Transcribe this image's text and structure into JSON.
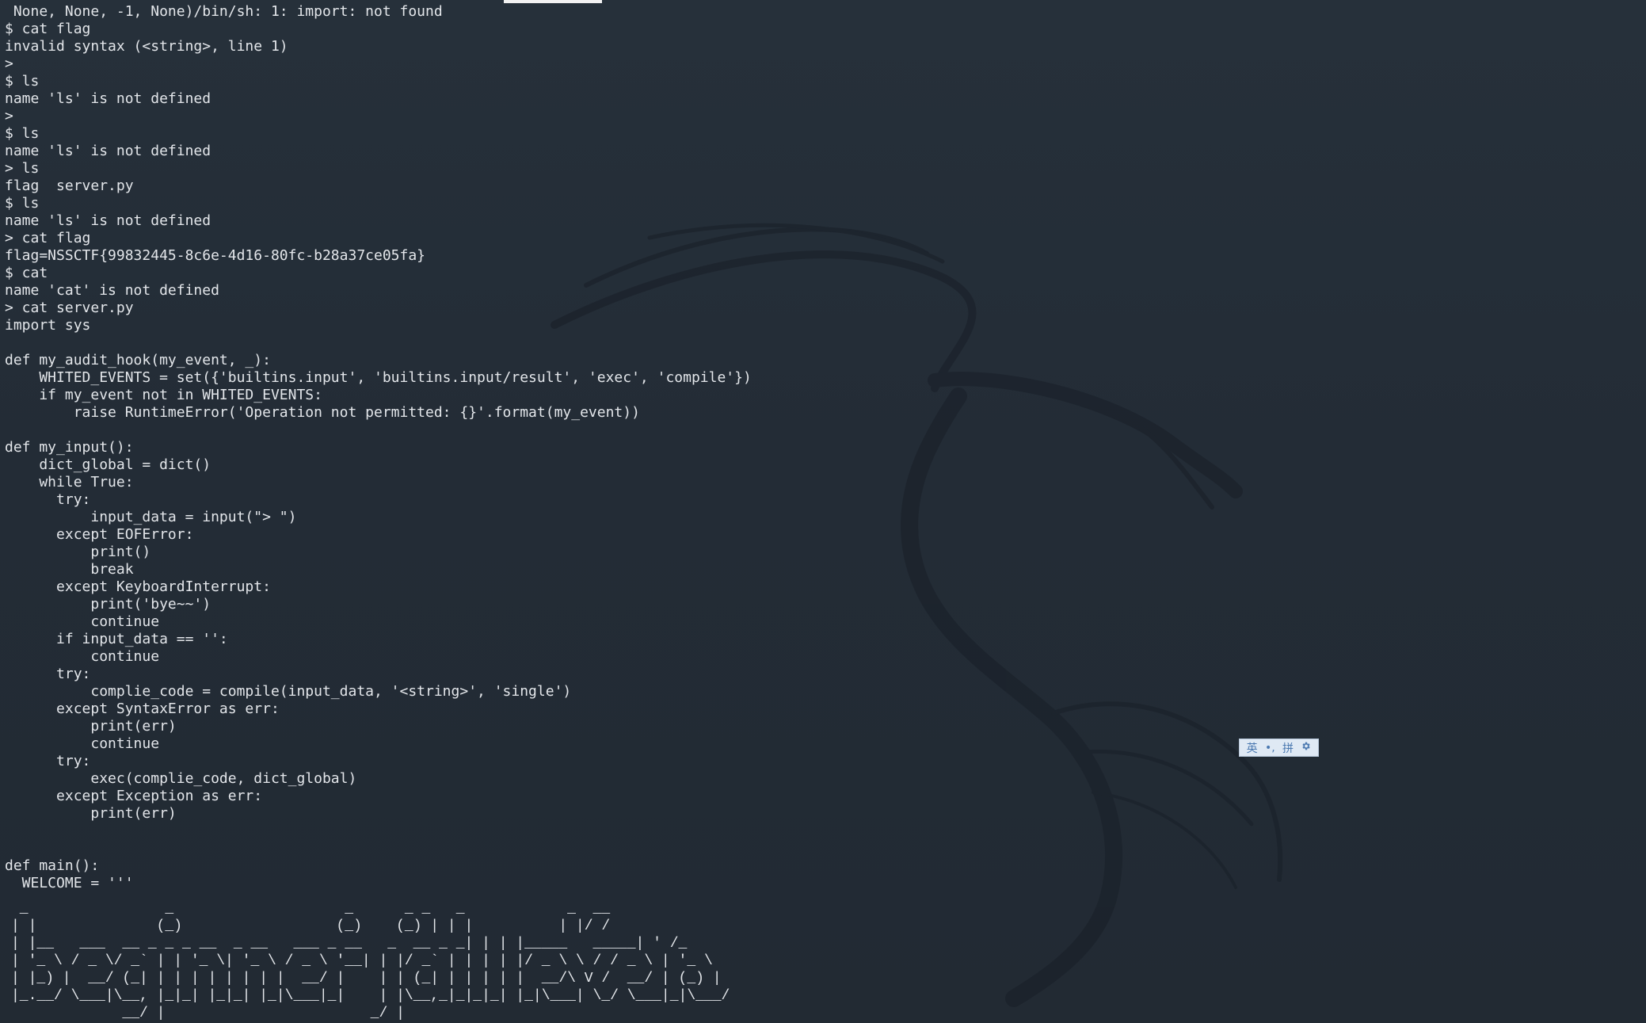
{
  "terminal": {
    "lines": [
      " None, None, -1, None)/bin/sh: 1: import: not found",
      "$ cat flag",
      "invalid syntax (<string>, line 1)",
      ">",
      "$ ls",
      "name 'ls' is not defined",
      ">",
      "$ ls",
      "name 'ls' is not defined",
      "> ls",
      "flag  server.py",
      "$ ls",
      "name 'ls' is not defined",
      "> cat flag",
      "flag=NSSCTF{99832445-8c6e-4d16-80fc-b28a37ce05fa}",
      "$ cat",
      "name 'cat' is not defined",
      "> cat server.py",
      "import sys",
      "",
      "def my_audit_hook(my_event, _):",
      "    WHITED_EVENTS = set({'builtins.input', 'builtins.input/result', 'exec', 'compile'})",
      "    if my_event not in WHITED_EVENTS:",
      "        raise RuntimeError('Operation not permitted: {}'.format(my_event))",
      "",
      "def my_input():",
      "    dict_global = dict()",
      "    while True:",
      "      try:",
      "          input_data = input(\"> \")",
      "      except EOFError:",
      "          print()",
      "          break",
      "      except KeyboardInterrupt:",
      "          print('bye~~')",
      "          continue",
      "      if input_data == '':",
      "          continue",
      "      try:",
      "          complie_code = compile(input_data, '<string>', 'single')",
      "      except SyntaxError as err:",
      "          print(err)",
      "          continue",
      "      try:",
      "          exec(complie_code, dict_global)",
      "      except Exception as err:",
      "          print(err)",
      "",
      "",
      "def main():",
      "  WELCOME = '''"
    ],
    "ascii_art": [
      " _                _                    _      _ _   _            _  __",
      "| |              (_)                  (_)    (_) | | |          | |/ /",
      "| |__   ___  __ _ _ _ __  _ __   ___ _ __   _  __ _ _| | | |_____   _____| ' /_",
      "| '_ \\ / _ \\/ _` | | '_ \\| '_ \\ / _ \\ '__| | |/ _` | | | | |/ _ \\ \\ / / _ \\ | '_ \\",
      "| |_) |  __/ (_| | | | | | | | |  __/ |    | | (_| | | | | |  __/\\ V /  __/ | (_) |",
      "|_.__/ \\___|\\__, |_|_| |_|_| |_|\\___|_|    | |\\__,_|_|_|_| |_|\\___| \\_/ \\___|_|\\___/",
      "             __/ |                        _/ |",
      "            |___/                        |__/"
    ]
  },
  "ime_toolbar": {
    "lang": "英",
    "punct": "•,",
    "mode": "拼",
    "settings_icon": "gear-icon"
  },
  "colors": {
    "background": "#232b35",
    "text": "#e3e6ea",
    "ime_bg": "#dfe9f4",
    "ime_text": "#4a78b0"
  }
}
